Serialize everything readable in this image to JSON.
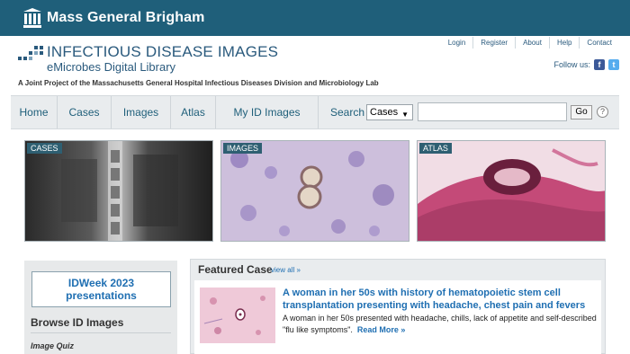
{
  "brand": {
    "name": "Mass General Brigham"
  },
  "header": {
    "title": "INFECTIOUS DISEASE IMAGES",
    "subtitle": "eMicrobes Digital Library",
    "tagline": "A Joint Project of the Massachusetts General Hospital Infectious Diseases Division and Microbiology Lab",
    "links": [
      "Login",
      "Register",
      "About",
      "Help",
      "Contact"
    ],
    "follow_label": "Follow us:"
  },
  "nav": {
    "items": [
      "Home",
      "Cases",
      "Images",
      "Atlas",
      "My ID Images"
    ],
    "search_label": "Search",
    "search_select": "Cases",
    "go_label": "Go",
    "help_label": "?"
  },
  "tiles": [
    "CASES",
    "IMAGES",
    "ATLAS"
  ],
  "sidebar": {
    "idweek_line1": "IDWeek 2023",
    "idweek_line2": "presentations",
    "browse_title": "Browse ID Images",
    "image_quiz": "Image Quiz"
  },
  "featured": {
    "heading": "Featured Case",
    "view_all": "view all »",
    "title": "A woman in her 50s with history of hematopoietic stem cell transplantation presenting with headache, chest pain and fevers",
    "text": "A woman in her 50s presented with headache, chills, lack of appetite and self-described \"flu like symptoms\".",
    "read_more": "Read More »"
  },
  "colors": {
    "brand_bar": "#1f5f7a",
    "link": "#1f6fb2",
    "nav_bg": "#e9ecee"
  }
}
